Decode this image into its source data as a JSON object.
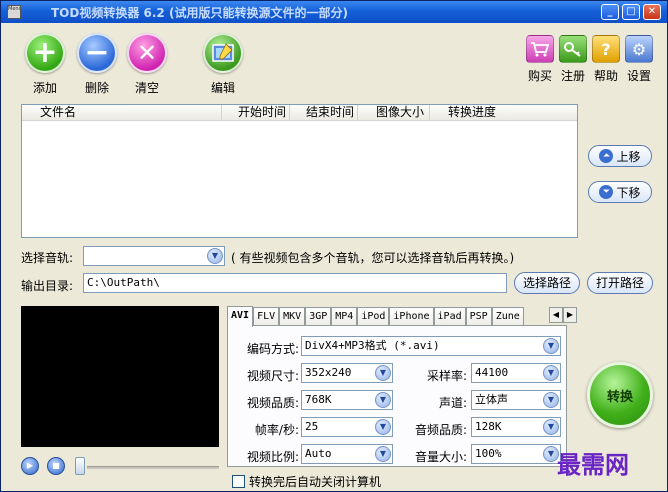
{
  "window": {
    "title": "TOD视频转换器 6.2 (试用版只能转换源文件的一部分)",
    "icon_text": "Mencoder"
  },
  "toolbar": {
    "add_label": "添加",
    "delete_label": "删除",
    "clear_label": "清空",
    "edit_label": "编辑",
    "buy_label": "购买",
    "register_label": "注册",
    "help_label": "帮助",
    "settings_label": "设置"
  },
  "filelist": {
    "columns": [
      "文件名",
      "开始时间",
      "结束时间",
      "图像大小",
      "转换进度"
    ],
    "rows": []
  },
  "side": {
    "up_label": "上移",
    "down_label": "下移"
  },
  "track": {
    "label": "选择音轨:",
    "value": "",
    "hint": "( 有些视频包含多个音轨，您可以选择音轨后再转换。)"
  },
  "output": {
    "label": "输出目录:",
    "path": "C:\\OutPath\\",
    "select_label": "选择路径",
    "open_label": "打开路径"
  },
  "tabs": [
    "AVI",
    "FLV",
    "MKV",
    "3GP",
    "MP4",
    "iPod",
    "iPhone",
    "iPad",
    "PSP",
    "Zune"
  ],
  "active_tab": "AVI",
  "settings": {
    "codec_label": "编码方式:",
    "codec_value": "DivX4+MP3格式 (*.avi)",
    "size_label": "视频尺寸:",
    "size_value": "352x240",
    "quality_label": "视频品质:",
    "quality_value": "768K",
    "fps_label": "帧率/秒:",
    "fps_value": "25",
    "ratio_label": "视频比例:",
    "ratio_value": "Auto",
    "samplerate_label": "采样率:",
    "samplerate_value": "44100",
    "channel_label": "声道:",
    "channel_value": "立体声",
    "audio_quality_label": "音频品质:",
    "audio_quality_value": "128K",
    "volume_label": "音量大小:",
    "volume_value": "100%"
  },
  "shutdown_label": "转换完后自动关闭计算机",
  "convert_label": "转换",
  "watermark": "最需网",
  "colors": {
    "titlebar": "#1560d8",
    "window_bg": "#ece9d8",
    "watermark": "#6a24c6",
    "convert_green": "#41b01a"
  }
}
